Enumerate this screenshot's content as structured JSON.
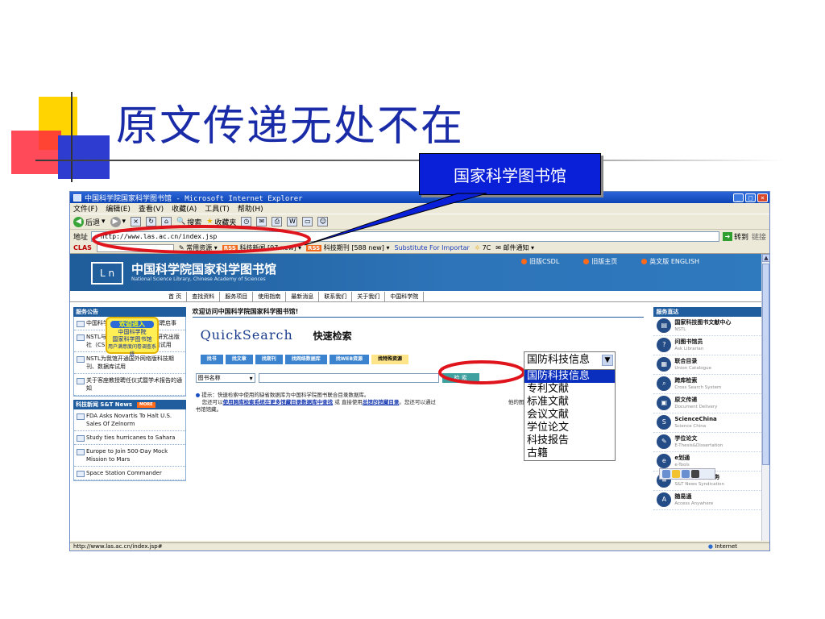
{
  "slide": {
    "title": "原文传递无处不在",
    "callout": "国家科学图书馆"
  },
  "browser": {
    "window_title": "中国科学院国家科学图书馆 - Microsoft Internet Explorer",
    "menu": [
      "文件(F)",
      "编辑(E)",
      "查看(V)",
      "收藏(A)",
      "工具(T)",
      "帮助(H)"
    ],
    "toolbar": {
      "back": "后退",
      "search": "搜索",
      "favorites": "收藏夹"
    },
    "address_label": "地址",
    "address_value": "http://www.las.ac.cn/index.jsp",
    "go_label": "转到",
    "links_label": "链接",
    "linksbar": {
      "clas": "CLAS",
      "common": "常用资源",
      "rss1": "RSS",
      "rss1_label": "科技新闻 [97 new]",
      "rss2": "RSS",
      "rss2_label": "科技期刊 [588 new]",
      "substitute": "Substitute For Importar",
      "temp": "7C",
      "mail": "邮件通知"
    },
    "status_url": "http://www.las.ac.cn/index.jsp#",
    "status_zone": "Internet"
  },
  "site": {
    "name": "中国科学院国家科学图书馆",
    "name_en": "National Science Library, Chinese Academy of Sciences",
    "top_links": [
      "旧版CSDL",
      "旧版主页",
      "英文版 ENGLISH"
    ],
    "nav": [
      "首 页",
      "查找资料",
      "服务项目",
      "使用指南",
      "最新消息",
      "联系我们",
      "关于我们",
      "中国科学院"
    ]
  },
  "left": {
    "notice_head": "服务公告",
    "notices": [
      "中国科学院国家科学图书馆招聘启事",
      "NSTL与澳大利亚联邦科学与研究出版社（CSIRO）网络版科技期刊试用",
      "NSTL为我馆开通国外网络版科技期刊、数据库试用",
      "关于客座教授聘任仪式暨学术报告的通知"
    ],
    "promo": {
      "head": "欢迎进入",
      "line1": "中国科学院",
      "line2": "国家科学图书馆",
      "line3": "用户满意度问卷调查系统"
    },
    "news_head": "科技新闻 S&T News",
    "more": "MORE",
    "news": [
      "FDA Asks Novartis To Halt U.S. Sales Of Zelnorm",
      "Study ties hurricanes to Sahara",
      "Europe to Join 500-Day Mock Mission to Mars",
      "Space Station Commander"
    ]
  },
  "middle": {
    "welcome": "欢迎访问中国科学院国家科学图书馆!",
    "qs_logo": "QuickSearch",
    "qs_title": "快速检索",
    "tabs": [
      "找书",
      "找文章",
      "找期刊",
      "找网络数据库",
      "找WEB资源",
      "找特殊资源"
    ],
    "field_select": "图书名称",
    "go": "检 索",
    "hint_prefix": "提示：快速检索中使用的缺省数据库为中国科学院图书联合目录数据库。",
    "hint_line2_a": "您还可以",
    "hint_link1": "使用跨库检索系统在更多馆藏目录数据库中查找",
    "hint_line2_b": "或 直接使用",
    "hint_link2": "总馆的馆藏目录",
    "hint_line2_c": "。您还可以通过",
    "hint_line2_d": "他的图",
    "hint_line3": "书馆馆藏。"
  },
  "dropdown": {
    "selected": "国防科技信息",
    "options": [
      "国防科技信息",
      "专利文献",
      "标准文献",
      "会议文献",
      "学位论文",
      "科技报告",
      "古籍"
    ]
  },
  "right": {
    "head": "服务直达",
    "items": [
      {
        "cn": "国家科技图书文献中心",
        "en": "NSTL"
      },
      {
        "cn": "问图书馆员",
        "en": "Ask Librarian"
      },
      {
        "cn": "联合目录",
        "en": "Union Catalogue"
      },
      {
        "cn": "跨库检索",
        "en": "Cross Search System"
      },
      {
        "cn": "原文传递",
        "en": "Document Delivery"
      },
      {
        "cn": "ScienceChina",
        "en": "Science China"
      },
      {
        "cn": "学位论文",
        "en": "E-Thesis&Dissertation"
      },
      {
        "cn": "e划通",
        "en": "e-Tools"
      },
      {
        "cn": "科技新闻聚合服务",
        "en": "S&T News Syndication"
      },
      {
        "cn": "随易通",
        "en": "Access Anywhere"
      }
    ]
  }
}
